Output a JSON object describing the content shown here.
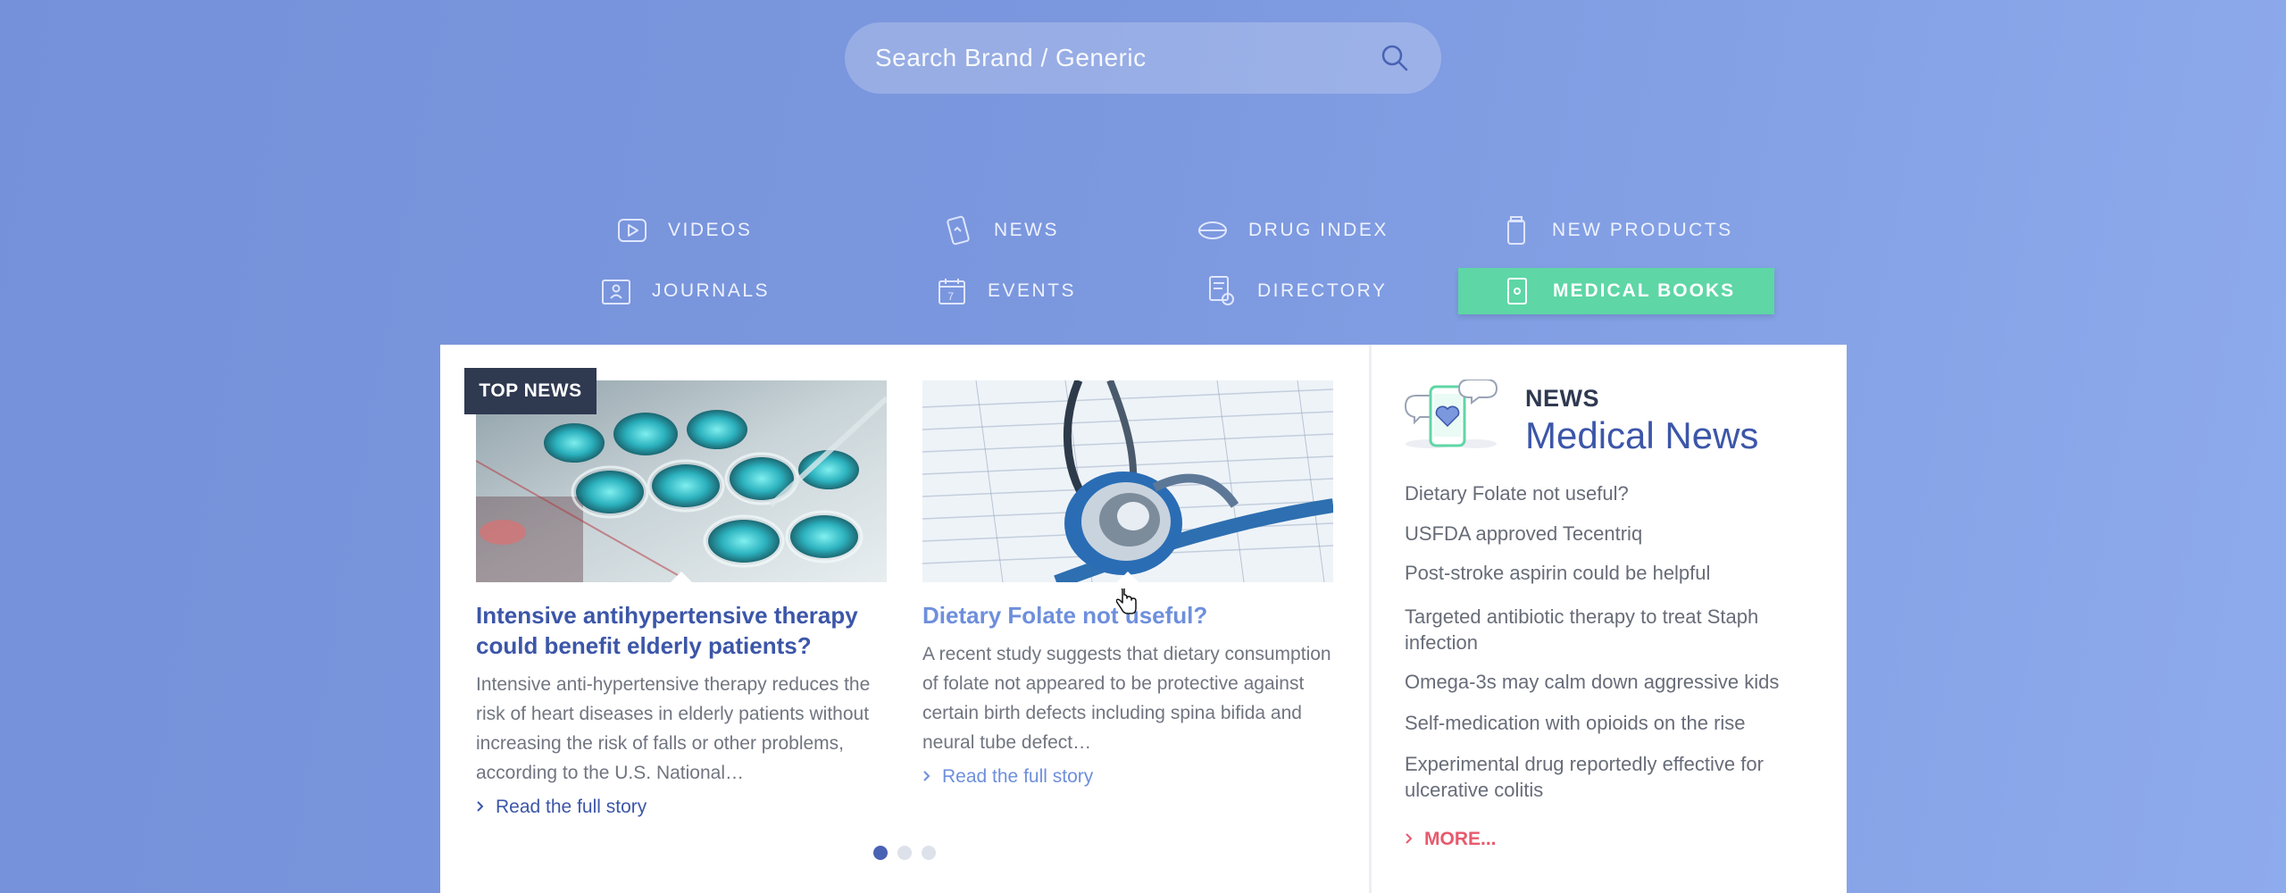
{
  "search": {
    "placeholder": "Search Brand / Generic"
  },
  "nav": {
    "videos": "VIDEOS",
    "news": "NEWS",
    "drug_index": "DRUG INDEX",
    "new_products": "NEW PRODUCTS",
    "journals": "JOURNALS",
    "events": "EVENTS",
    "directory": "DIRECTORY",
    "medical_books": "MEDICAL BOOKS",
    "events_icon_day": "7"
  },
  "top_news": {
    "badge": "TOP NEWS",
    "cards": [
      {
        "title": "Intensive antihypertensive therapy could benefit elderly patients?",
        "excerpt": "Intensive anti-hypertensive therapy reduces the risk of heart diseases in elderly patients without increasing the risk of falls or other problems, according to the U.S. National…",
        "read_more": "Read the full story"
      },
      {
        "title": "Dietary Folate not useful?",
        "excerpt": "A recent study suggests that dietary consumption of folate not appeared to be protective against certain birth defects including spina bifida and neural tube defect…",
        "read_more": "Read the full story"
      }
    ],
    "current_slide": 1,
    "total_slides": 3
  },
  "sidebar": {
    "kicker": "NEWS",
    "title": "Medical News",
    "items": [
      "Dietary Folate not useful?",
      "USFDA approved Tecentriq",
      "Post-stroke aspirin could be helpful",
      "Targeted antibiotic therapy to treat Staph infection",
      "Omega-3s may calm down aggressive kids",
      "Self-medication with opioids on the rise",
      "Experimental drug reportedly effective for ulcerative colitis"
    ],
    "more": "MORE..."
  },
  "colors": {
    "accent_green": "#5ed6a6",
    "title_blue": "#3c56a8",
    "badge_dark": "#2f3950",
    "more_red": "#e8596d"
  }
}
